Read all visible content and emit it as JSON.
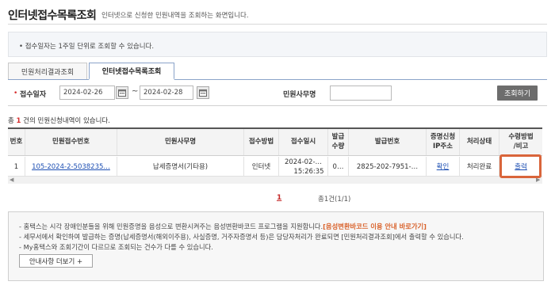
{
  "header": {
    "title": "인터넷접수목록조회",
    "subtitle": "인터넷으로 신청한 민원내역을 조회하는 화면입니다."
  },
  "info": {
    "text": "• 접수일자는 1주일 단위로 조회할 수 있습니다."
  },
  "tabs": [
    {
      "label": "민원처리결과조회",
      "active": false
    },
    {
      "label": "인터넷접수목록조회",
      "active": true
    }
  ],
  "search": {
    "required_mark": "•",
    "date_label": "접수일자",
    "date_from": "2024-02-26",
    "date_to": "2024-02-28",
    "tilde": "~",
    "office_label": "민원사무명",
    "office_value": "",
    "search_button": "조회하기"
  },
  "summary": {
    "prefix": "총 ",
    "count": "1",
    "suffix": " 건의 민원신청내역이 있습니다."
  },
  "table": {
    "headers": [
      "번호",
      "민원접수번호",
      "민원사무명",
      "접수방법",
      "접수일시",
      "발급\n수량",
      "발급번호",
      "증명신청\nIP주소",
      "처리상태",
      "수령방법\n/비고"
    ],
    "rows": [
      {
        "no": "1",
        "receipt_no": "105-2024-2-5038235…",
        "office": "납세증명서(기타용)",
        "method": "인터넷",
        "datetime_line1": "2024-02-…",
        "datetime_line2": "15:26:35",
        "quantity": "0…",
        "issue_no": "2825-202-7951-…",
        "ip": "확인",
        "status": "처리완료",
        "receive": "출력"
      }
    ]
  },
  "pagination": {
    "current": "1",
    "total": "총1건(1/1)"
  },
  "notice": {
    "line1_text": "- 홈택스는 시각 장애인분들을 위해 민원증명을 음성으로 변환시켜주는 음성변환바코드 프로그램을 지원합니다.",
    "line1_link": "[음성변환바코드 이용 안내 바로가기]",
    "line2": "- 세무서에서 확인하여 발급하는 증명(납세증명서(해외이주용), 사실증명, 거주자증명서 등)은 담당자처리가 완료되면 [민원처리결과조회]에서 출력할 수 있습니다.",
    "line3": "- My홈택스와 조회기간이 다르므로 조회되는 건수가 다를 수 있습니다.",
    "guide_button": "안내사항 더보기 +"
  },
  "icons": {
    "calendar": "calendar-icon",
    "scroll_left": "scroll-left-icon",
    "scroll_right": "scroll-right-icon"
  },
  "colors": {
    "accent_red": "#d62c2c",
    "link_blue": "#1d4fb3",
    "highlight_orange": "#d9653b",
    "button_gray": "#6d6d6d"
  }
}
